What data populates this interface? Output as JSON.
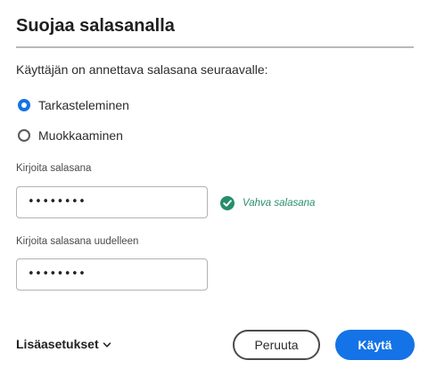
{
  "dialog": {
    "title": "Suojaa salasanalla",
    "intro": "Käyttäjän on annettava salasana seuraavalle:",
    "options": [
      {
        "label": "Tarkasteleminen",
        "selected": true
      },
      {
        "label": "Muokkaaminen",
        "selected": false
      }
    ],
    "password": {
      "label": "Kirjoita salasana",
      "value": "••••••••",
      "strength_text": "Vahva salasana",
      "strength_icon": "check-circle-icon"
    },
    "confirm": {
      "label": "Kirjoita salasana uudelleen",
      "value": "••••••••"
    },
    "advanced_label": "Lisäasetukset",
    "advanced_icon": "chevron-down-icon",
    "buttons": {
      "cancel": "Peruuta",
      "apply": "Käytä"
    },
    "colors": {
      "accent": "#1473e6",
      "success": "#268e6c",
      "divider": "#b9b9b9"
    }
  }
}
